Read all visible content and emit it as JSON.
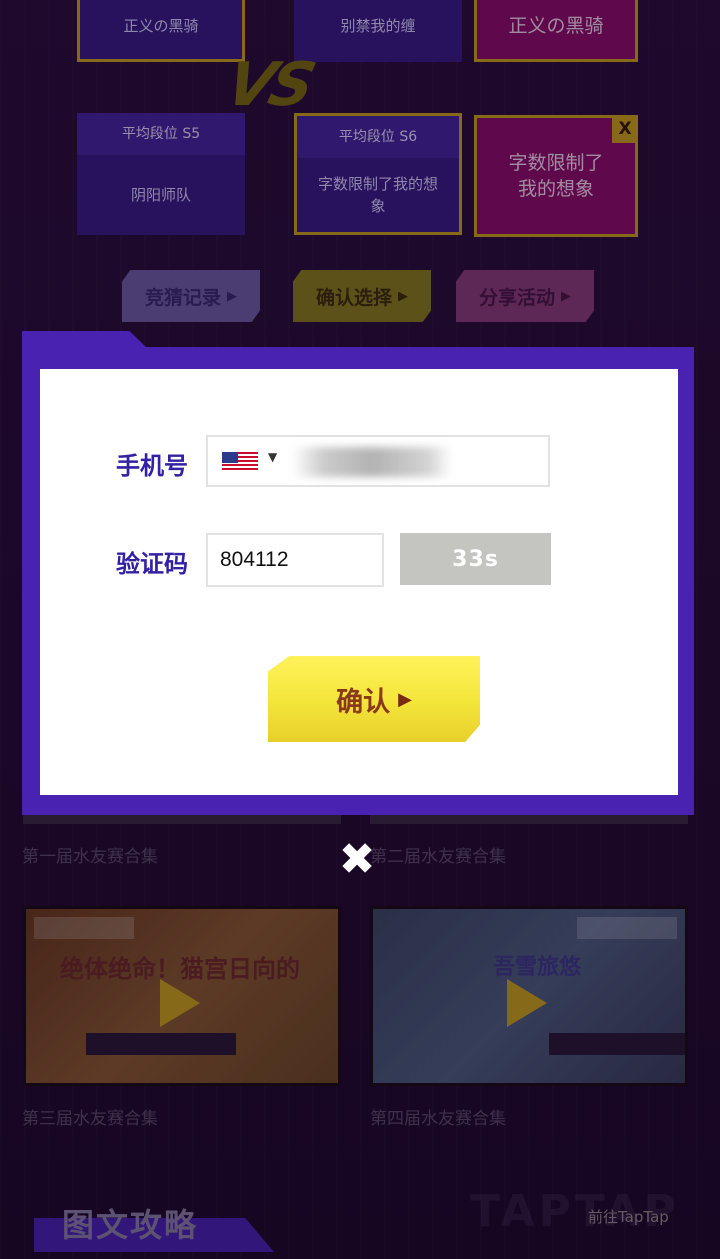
{
  "teams": {
    "left_top_name": "正义の黑骑",
    "mid_top_name": "别禁我的缠",
    "right_top_name": "正义の黑骑",
    "vs_label": "VS",
    "left_avg": "平均段位 S5",
    "left_name": "阴阳师队",
    "mid_avg": "平均段位 S6",
    "mid_name": "字数限制了我的想象",
    "right_name": "字数限制了我的想象",
    "right_badge": "X"
  },
  "actions": {
    "guess_record": "竞猜记录",
    "confirm_select": "确认选择",
    "share_activity": "分享活动"
  },
  "modal": {
    "phone_label": "手机号",
    "code_label": "验证码",
    "code_value": "804112",
    "timer": "33s",
    "confirm_label": "确认"
  },
  "videos": [
    {
      "title": "第一届水友赛合集"
    },
    {
      "title": "第二届水友赛合集"
    },
    {
      "title": "第三届水友赛合集",
      "headline": "绝体绝命！猫宫日向的"
    },
    {
      "title": "第四届水友赛合集",
      "headline": "吾雪旅悠"
    }
  ],
  "footer": {
    "section_title": "图文攻略",
    "taptap_link": "前往TapTap",
    "ghost": "TAPTAP"
  },
  "colors": {
    "accent_purple": "#4a22b2",
    "gold": "#c9a21e",
    "confirm_yellow": "#f3e53a"
  }
}
